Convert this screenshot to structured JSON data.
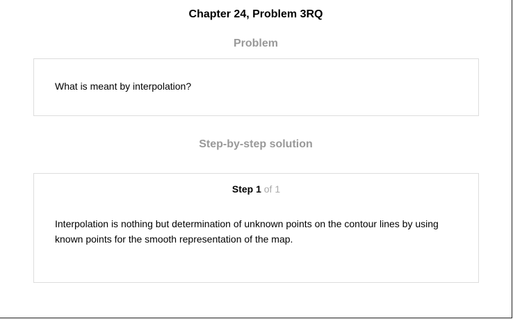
{
  "header": {
    "chapter_title": "Chapter 24, Problem 3RQ"
  },
  "problem": {
    "heading": "Problem",
    "text": "What is meant by interpolation?"
  },
  "solution": {
    "heading": "Step-by-step solution",
    "step_label": "Step 1",
    "step_total": "of 1",
    "text": "Interpolation is nothing but determination of unknown points on the contour lines by using known points for the smooth representation of the map."
  },
  "colors": {
    "heading_gray": "#999999",
    "step_total_gray": "#aaaaaa",
    "box_border": "#dddddd"
  }
}
